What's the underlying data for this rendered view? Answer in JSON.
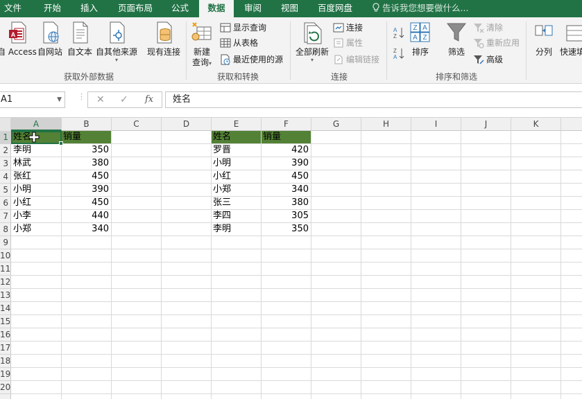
{
  "menu": {
    "tabs": [
      {
        "label": "文件",
        "active": false
      },
      {
        "label": "开始",
        "active": false
      },
      {
        "label": "插入",
        "active": false
      },
      {
        "label": "页面布局",
        "active": false
      },
      {
        "label": "公式",
        "active": false
      },
      {
        "label": "数据",
        "active": true
      },
      {
        "label": "审阅",
        "active": false
      },
      {
        "label": "视图",
        "active": false
      },
      {
        "label": "百度网盘",
        "active": false
      }
    ],
    "tell_me": "告诉我您想要做什么..."
  },
  "ribbon": {
    "get_external": {
      "access": "自 Access",
      "web": "自网站",
      "text": "自文本",
      "other": "自其他来源",
      "existing": "现有连接",
      "group_label": "获取外部数据"
    },
    "get_transform": {
      "new_query": "新建",
      "new_query_2": "查询",
      "show_queries": "显示查询",
      "from_table": "从表格",
      "recent_sources": "最近使用的源",
      "group_label": "获取和转换"
    },
    "connections": {
      "refresh_all": "全部刷新",
      "connections": "连接",
      "properties": "属性",
      "edit_links": "编辑链接",
      "group_label": "连接"
    },
    "sort_filter": {
      "sort": "排序",
      "filter": "筛选",
      "clear": "清除",
      "reapply": "重新应用",
      "advanced": "高级",
      "group_label": "排序和筛选"
    },
    "data_tools": {
      "text_to_columns": "分列",
      "flash_fill": "快速填"
    }
  },
  "formula_bar": {
    "name_box": "A1",
    "fx": "fx",
    "content": "姓名"
  },
  "sheet": {
    "columns": [
      "A",
      "B",
      "C",
      "D",
      "E",
      "F",
      "G",
      "H",
      "I",
      "J",
      "K"
    ],
    "rows": [
      "1",
      "2",
      "3",
      "4",
      "5",
      "6",
      "7",
      "8",
      "9",
      "10",
      "11",
      "12",
      "13",
      "14",
      "15",
      "16",
      "17",
      "18",
      "19",
      "20"
    ],
    "table1": {
      "headers": [
        "姓名",
        "销量"
      ],
      "rows": [
        [
          "李明",
          "350"
        ],
        [
          "林武",
          "380"
        ],
        [
          "张红",
          "450"
        ],
        [
          "小明",
          "390"
        ],
        [
          "小红",
          "450"
        ],
        [
          "小李",
          "440"
        ],
        [
          "小郑",
          "340"
        ]
      ]
    },
    "table2": {
      "headers": [
        "姓名",
        "销量"
      ],
      "rows": [
        [
          "罗晋",
          "420"
        ],
        [
          "小明",
          "390"
        ],
        [
          "小红",
          "450"
        ],
        [
          "小郑",
          "340"
        ],
        [
          "张三",
          "380"
        ],
        [
          "李四",
          "305"
        ],
        [
          "李明",
          "350"
        ]
      ]
    },
    "header_fill": "#538135",
    "accent": "#217346"
  }
}
